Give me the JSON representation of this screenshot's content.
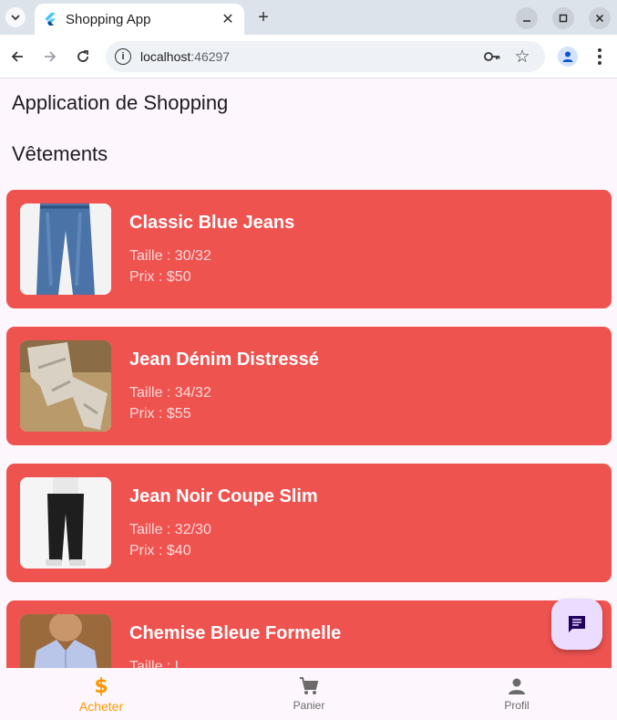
{
  "browser": {
    "tab_title": "Shopping App",
    "url_host": "localhost",
    "url_port": ":46297"
  },
  "app": {
    "title": "Application de Shopping",
    "section": "Vêtements"
  },
  "products": [
    {
      "name": "Classic Blue Jeans",
      "size": "Taille : 30/32",
      "price": "Prix : $50"
    },
    {
      "name": "Jean Dénim Distressé",
      "size": "Taille : 34/32",
      "price": "Prix : $55"
    },
    {
      "name": "Jean Noir Coupe Slim",
      "size": "Taille : 32/30",
      "price": "Prix : $40"
    },
    {
      "name": "Chemise Bleue Formelle",
      "size": "Taille : L",
      "price": ""
    }
  ],
  "bottom_nav": {
    "items": [
      {
        "label": "Acheter",
        "icon": "dollar-icon"
      },
      {
        "label": "Panier",
        "icon": "cart-icon"
      },
      {
        "label": "Profil",
        "icon": "person-icon"
      }
    ],
    "active_index": 0
  },
  "colors": {
    "card": "#ef5350",
    "accent": "#ff9800",
    "fab": "#eaddff"
  }
}
